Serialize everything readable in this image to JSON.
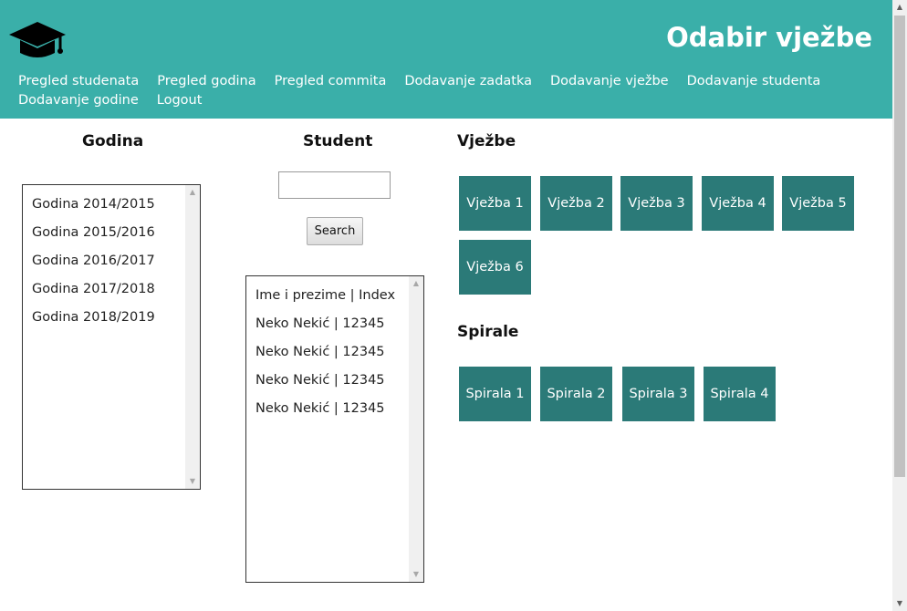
{
  "header": {
    "title": "Odabir vježbe",
    "logo_icon": "graduation-cap-icon",
    "background_color": "#3aafa9"
  },
  "nav": {
    "items": [
      {
        "label": "Pregled studenata"
      },
      {
        "label": "Pregled godina"
      },
      {
        "label": "Pregled commita"
      },
      {
        "label": "Dodavanje zadatka"
      },
      {
        "label": "Dodavanje vježbe"
      },
      {
        "label": "Dodavanje studenta"
      },
      {
        "label": "Dodavanje godine"
      },
      {
        "label": "Logout"
      }
    ]
  },
  "godina": {
    "heading": "Godina",
    "items": [
      {
        "label": "Godina 2014/2015"
      },
      {
        "label": "Godina 2015/2016"
      },
      {
        "label": "Godina 2016/2017"
      },
      {
        "label": "Godina 2017/2018"
      },
      {
        "label": "Godina 2018/2019"
      }
    ]
  },
  "student": {
    "heading": "Student",
    "search": {
      "value": "",
      "placeholder": "",
      "button_label": "Search"
    },
    "items": [
      {
        "label": "Ime i prezime | Index"
      },
      {
        "label": "Neko Nekić | 12345"
      },
      {
        "label": "Neko Nekić | 12345"
      },
      {
        "label": "Neko Nekić | 12345"
      },
      {
        "label": "Neko Nekić | 12345"
      }
    ]
  },
  "vjezbe": {
    "heading": "Vježbe",
    "tiles": [
      {
        "label": "Vježba 1"
      },
      {
        "label": "Vježba 2"
      },
      {
        "label": "Vježba 3"
      },
      {
        "label": "Vježba 4"
      },
      {
        "label": "Vježba 5"
      },
      {
        "label": "Vježba 6"
      }
    ],
    "tile_color": "#2b7a78"
  },
  "spirale": {
    "heading": "Spirale",
    "tiles": [
      {
        "label": "Spirala 1"
      },
      {
        "label": "Spirala 2"
      },
      {
        "label": "Spirala 3"
      },
      {
        "label": "Spirala 4"
      }
    ]
  }
}
